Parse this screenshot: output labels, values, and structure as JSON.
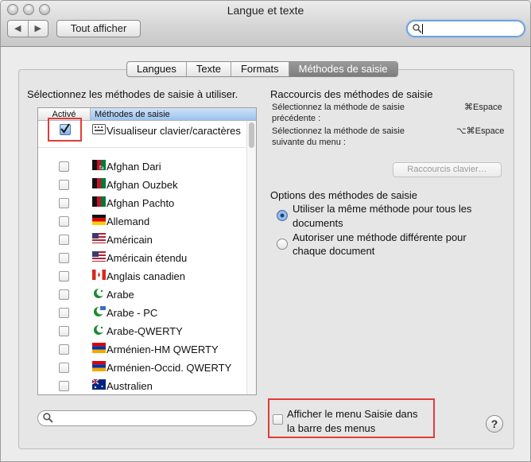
{
  "window": {
    "title": "Langue et texte"
  },
  "toolbar": {
    "back_glyph": "◀",
    "forward_glyph": "▶",
    "show_all_label": "Tout afficher",
    "search_value": ""
  },
  "tabs": [
    {
      "label": "Langues",
      "active": false
    },
    {
      "label": "Texte",
      "active": false
    },
    {
      "label": "Formats",
      "active": false
    },
    {
      "label": "Méthodes de saisie",
      "active": true
    }
  ],
  "left": {
    "title": "Sélectionnez les méthodes de saisie à utiliser.",
    "columns": {
      "active": "Activé",
      "methods": "Méthodes de saisie"
    },
    "top_item": {
      "label": "Visualiseur clavier/caractères",
      "checked": true,
      "icon": "keyboard-viewer-icon"
    },
    "items": [
      {
        "label": "Afghan Dari",
        "checked": false,
        "icon": "flag-afghanistan-icon"
      },
      {
        "label": "Afghan Ouzbek",
        "checked": false,
        "icon": "flag-afghanistan-icon"
      },
      {
        "label": "Afghan Pachto",
        "checked": false,
        "icon": "flag-afghanistan-icon"
      },
      {
        "label": "Allemand",
        "checked": false,
        "icon": "flag-germany-icon"
      },
      {
        "label": "Américain",
        "checked": false,
        "icon": "flag-usa-icon"
      },
      {
        "label": "Américain étendu",
        "checked": false,
        "icon": "flag-usa-icon"
      },
      {
        "label": "Anglais canadien",
        "checked": false,
        "icon": "flag-canada-icon"
      },
      {
        "label": "Arabe",
        "checked": false,
        "icon": "crescent-icon"
      },
      {
        "label": "Arabe - PC",
        "checked": false,
        "icon": "crescent-icon"
      },
      {
        "label": "Arabe-QWERTY",
        "checked": false,
        "icon": "crescent-icon"
      },
      {
        "label": "Arménien-HM QWERTY",
        "checked": false,
        "icon": "flag-armenia-icon"
      },
      {
        "label": "Arménien-Occid. QWERTY",
        "checked": false,
        "icon": "flag-armenia-icon"
      },
      {
        "label": "Australien",
        "checked": false,
        "icon": "flag-australia-icon"
      }
    ],
    "search_value": ""
  },
  "right": {
    "shortcuts_title": "Raccourcis des méthodes de saisie",
    "shortcut_prev_line1": "Sélectionnez la méthode de saisie",
    "shortcut_prev_line2": "précédente :",
    "shortcut_prev_key": "⌘Espace",
    "shortcut_next_line1": "Sélectionnez la méthode de saisie",
    "shortcut_next_line2": "suivante du menu :",
    "shortcut_next_key": "⌥⌘Espace",
    "shortcuts_button": "Raccourcis clavier…",
    "options_title": "Options des méthodes de saisie",
    "option1_line1": "Utiliser la même méthode pour tous les",
    "option1_line2": "documents",
    "option1_selected": true,
    "option2_line1": "Autoriser une méthode différente pour",
    "option2_line2": "chaque document",
    "option2_selected": false
  },
  "footer": {
    "show_menu_line1": "Afficher le menu Saisie dans",
    "show_menu_line2": "la barre des menus",
    "show_menu_checked": false,
    "help_label": "?"
  },
  "colors": {
    "highlight_red": "#e23b3b",
    "selection_blue": "#9cc2ef",
    "tab_active": "#7d7d7d"
  }
}
